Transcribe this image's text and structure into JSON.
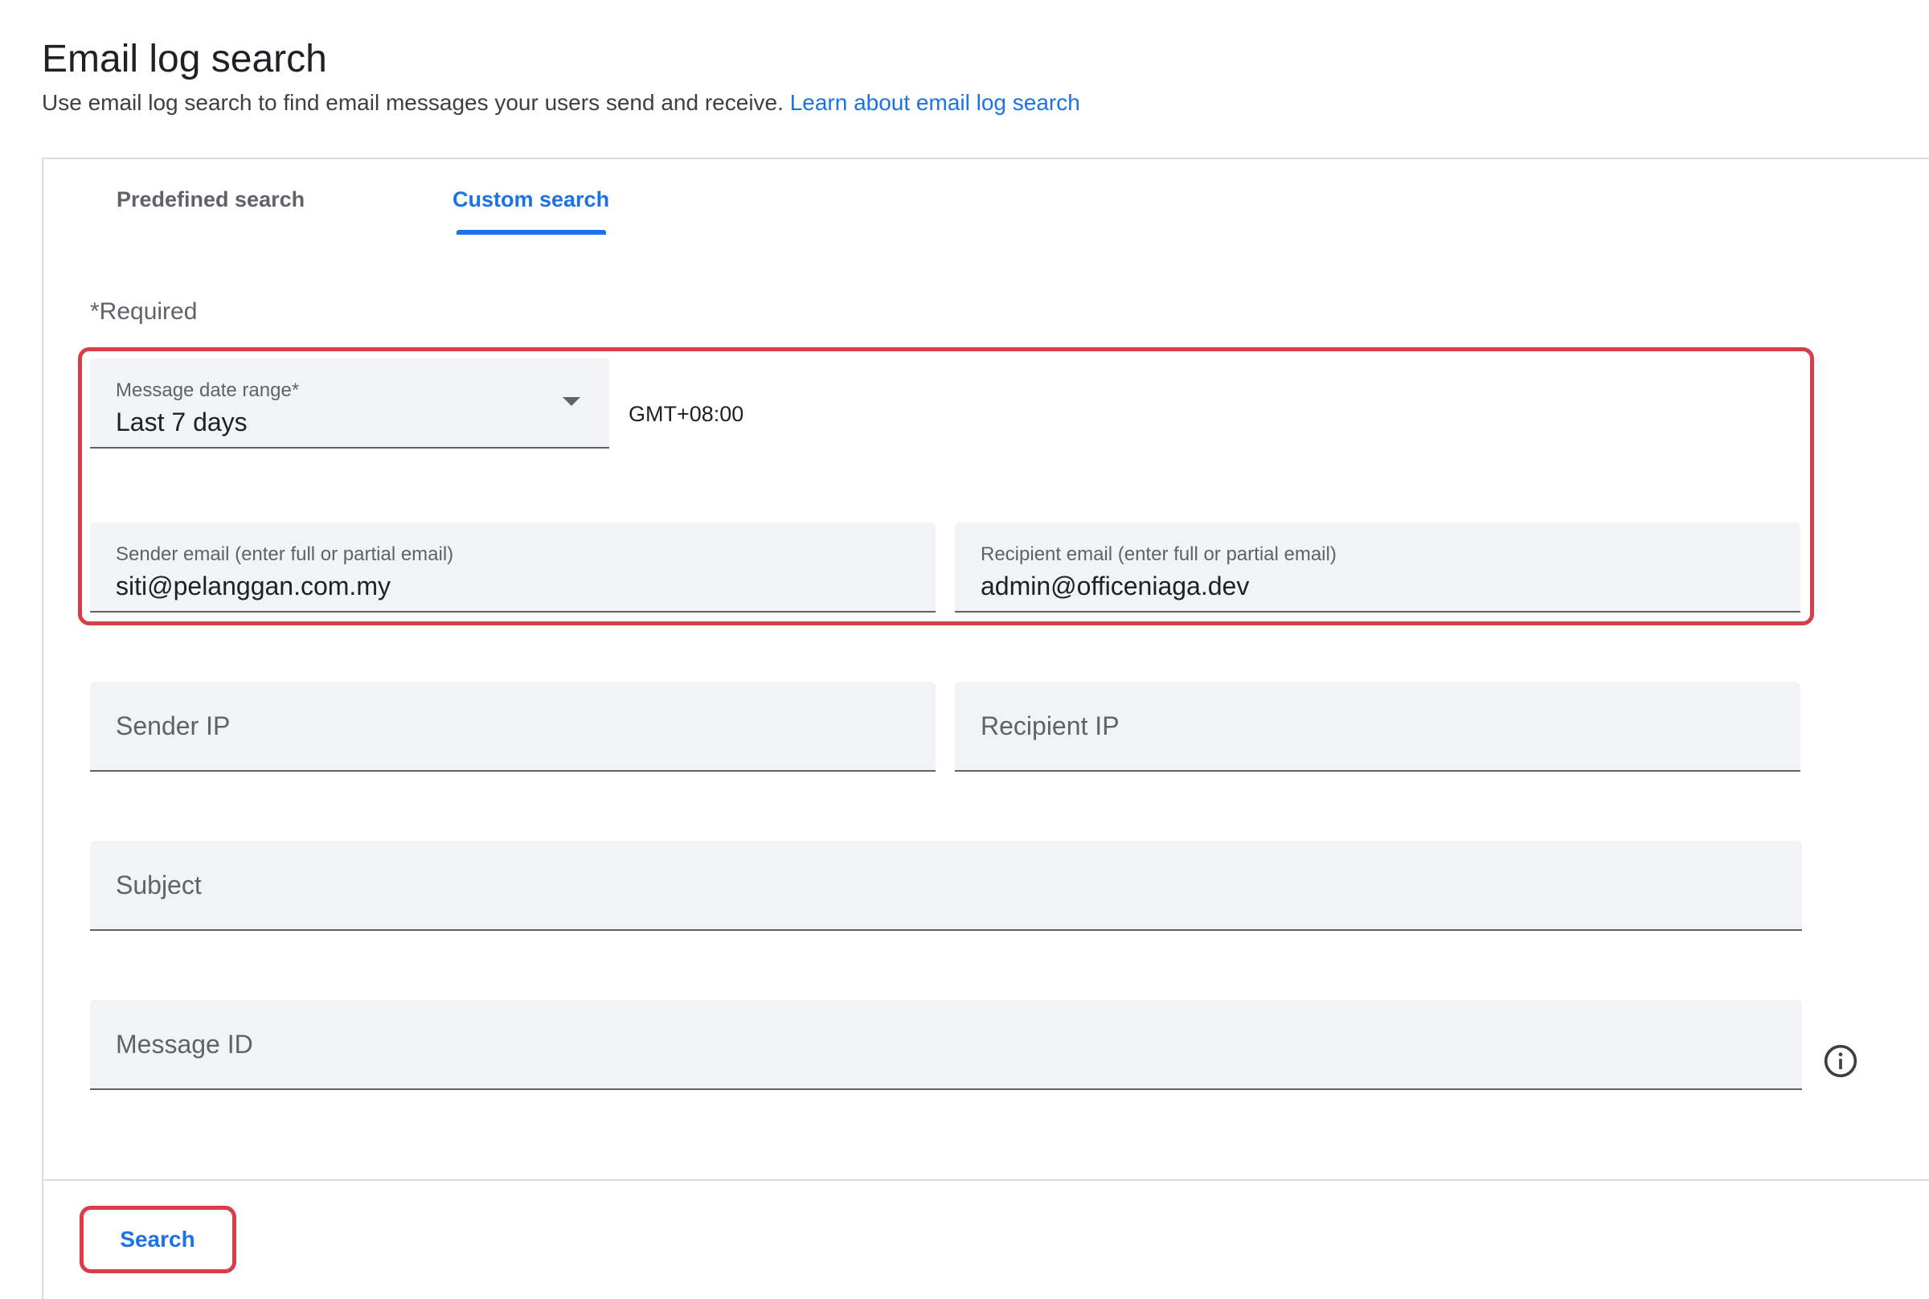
{
  "page": {
    "title": "Email log search",
    "description": "Use email log search to find email messages your users send and receive.",
    "learn_link": "Learn about email log search"
  },
  "tabs": [
    {
      "label": "Predefined search",
      "active": false
    },
    {
      "label": "Custom search",
      "active": true
    }
  ],
  "form": {
    "required_note": "*Required",
    "date_range": {
      "label": "Message date range*",
      "value": "Last 7 days"
    },
    "timezone": "GMT+08:00",
    "sender_email": {
      "label": "Sender email (enter full or partial email)",
      "value": "siti@pelanggan.com.my"
    },
    "recipient_email": {
      "label": "Recipient email (enter full or partial email)",
      "value": "admin@officeniaga.dev"
    },
    "sender_ip": {
      "placeholder": "Sender IP"
    },
    "recipient_ip": {
      "placeholder": "Recipient IP"
    },
    "subject": {
      "placeholder": "Subject"
    },
    "message_id": {
      "placeholder": "Message ID"
    }
  },
  "actions": {
    "search_label": "Search"
  },
  "colors": {
    "accent": "#1a73e8",
    "highlight": "#d93d48",
    "field_bg": "#f1f3f4"
  },
  "icons": {
    "dropdown": "arrow-drop-down-icon",
    "info": "info-icon"
  }
}
